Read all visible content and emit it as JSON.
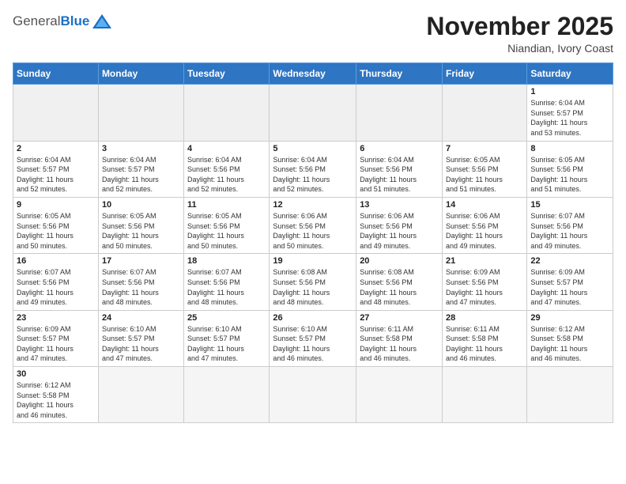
{
  "header": {
    "logo": {
      "general": "General",
      "blue": "Blue"
    },
    "title": "November 2025",
    "location": "Niandian, Ivory Coast"
  },
  "weekdays": [
    "Sunday",
    "Monday",
    "Tuesday",
    "Wednesday",
    "Thursday",
    "Friday",
    "Saturday"
  ],
  "weeks": [
    [
      {
        "day": "",
        "info": ""
      },
      {
        "day": "",
        "info": ""
      },
      {
        "day": "",
        "info": ""
      },
      {
        "day": "",
        "info": ""
      },
      {
        "day": "",
        "info": ""
      },
      {
        "day": "",
        "info": ""
      },
      {
        "day": "1",
        "info": "Sunrise: 6:04 AM\nSunset: 5:57 PM\nDaylight: 11 hours\nand 53 minutes."
      }
    ],
    [
      {
        "day": "2",
        "info": "Sunrise: 6:04 AM\nSunset: 5:57 PM\nDaylight: 11 hours\nand 52 minutes."
      },
      {
        "day": "3",
        "info": "Sunrise: 6:04 AM\nSunset: 5:57 PM\nDaylight: 11 hours\nand 52 minutes."
      },
      {
        "day": "4",
        "info": "Sunrise: 6:04 AM\nSunset: 5:56 PM\nDaylight: 11 hours\nand 52 minutes."
      },
      {
        "day": "5",
        "info": "Sunrise: 6:04 AM\nSunset: 5:56 PM\nDaylight: 11 hours\nand 52 minutes."
      },
      {
        "day": "6",
        "info": "Sunrise: 6:04 AM\nSunset: 5:56 PM\nDaylight: 11 hours\nand 51 minutes."
      },
      {
        "day": "7",
        "info": "Sunrise: 6:05 AM\nSunset: 5:56 PM\nDaylight: 11 hours\nand 51 minutes."
      },
      {
        "day": "8",
        "info": "Sunrise: 6:05 AM\nSunset: 5:56 PM\nDaylight: 11 hours\nand 51 minutes."
      }
    ],
    [
      {
        "day": "9",
        "info": "Sunrise: 6:05 AM\nSunset: 5:56 PM\nDaylight: 11 hours\nand 50 minutes."
      },
      {
        "day": "10",
        "info": "Sunrise: 6:05 AM\nSunset: 5:56 PM\nDaylight: 11 hours\nand 50 minutes."
      },
      {
        "day": "11",
        "info": "Sunrise: 6:05 AM\nSunset: 5:56 PM\nDaylight: 11 hours\nand 50 minutes."
      },
      {
        "day": "12",
        "info": "Sunrise: 6:06 AM\nSunset: 5:56 PM\nDaylight: 11 hours\nand 50 minutes."
      },
      {
        "day": "13",
        "info": "Sunrise: 6:06 AM\nSunset: 5:56 PM\nDaylight: 11 hours\nand 49 minutes."
      },
      {
        "day": "14",
        "info": "Sunrise: 6:06 AM\nSunset: 5:56 PM\nDaylight: 11 hours\nand 49 minutes."
      },
      {
        "day": "15",
        "info": "Sunrise: 6:07 AM\nSunset: 5:56 PM\nDaylight: 11 hours\nand 49 minutes."
      }
    ],
    [
      {
        "day": "16",
        "info": "Sunrise: 6:07 AM\nSunset: 5:56 PM\nDaylight: 11 hours\nand 49 minutes."
      },
      {
        "day": "17",
        "info": "Sunrise: 6:07 AM\nSunset: 5:56 PM\nDaylight: 11 hours\nand 48 minutes."
      },
      {
        "day": "18",
        "info": "Sunrise: 6:07 AM\nSunset: 5:56 PM\nDaylight: 11 hours\nand 48 minutes."
      },
      {
        "day": "19",
        "info": "Sunrise: 6:08 AM\nSunset: 5:56 PM\nDaylight: 11 hours\nand 48 minutes."
      },
      {
        "day": "20",
        "info": "Sunrise: 6:08 AM\nSunset: 5:56 PM\nDaylight: 11 hours\nand 48 minutes."
      },
      {
        "day": "21",
        "info": "Sunrise: 6:09 AM\nSunset: 5:56 PM\nDaylight: 11 hours\nand 47 minutes."
      },
      {
        "day": "22",
        "info": "Sunrise: 6:09 AM\nSunset: 5:57 PM\nDaylight: 11 hours\nand 47 minutes."
      }
    ],
    [
      {
        "day": "23",
        "info": "Sunrise: 6:09 AM\nSunset: 5:57 PM\nDaylight: 11 hours\nand 47 minutes."
      },
      {
        "day": "24",
        "info": "Sunrise: 6:10 AM\nSunset: 5:57 PM\nDaylight: 11 hours\nand 47 minutes."
      },
      {
        "day": "25",
        "info": "Sunrise: 6:10 AM\nSunset: 5:57 PM\nDaylight: 11 hours\nand 47 minutes."
      },
      {
        "day": "26",
        "info": "Sunrise: 6:10 AM\nSunset: 5:57 PM\nDaylight: 11 hours\nand 46 minutes."
      },
      {
        "day": "27",
        "info": "Sunrise: 6:11 AM\nSunset: 5:58 PM\nDaylight: 11 hours\nand 46 minutes."
      },
      {
        "day": "28",
        "info": "Sunrise: 6:11 AM\nSunset: 5:58 PM\nDaylight: 11 hours\nand 46 minutes."
      },
      {
        "day": "29",
        "info": "Sunrise: 6:12 AM\nSunset: 5:58 PM\nDaylight: 11 hours\nand 46 minutes."
      }
    ],
    [
      {
        "day": "30",
        "info": "Sunrise: 6:12 AM\nSunset: 5:58 PM\nDaylight: 11 hours\nand 46 minutes."
      },
      {
        "day": "",
        "info": ""
      },
      {
        "day": "",
        "info": ""
      },
      {
        "day": "",
        "info": ""
      },
      {
        "day": "",
        "info": ""
      },
      {
        "day": "",
        "info": ""
      },
      {
        "day": "",
        "info": ""
      }
    ]
  ]
}
